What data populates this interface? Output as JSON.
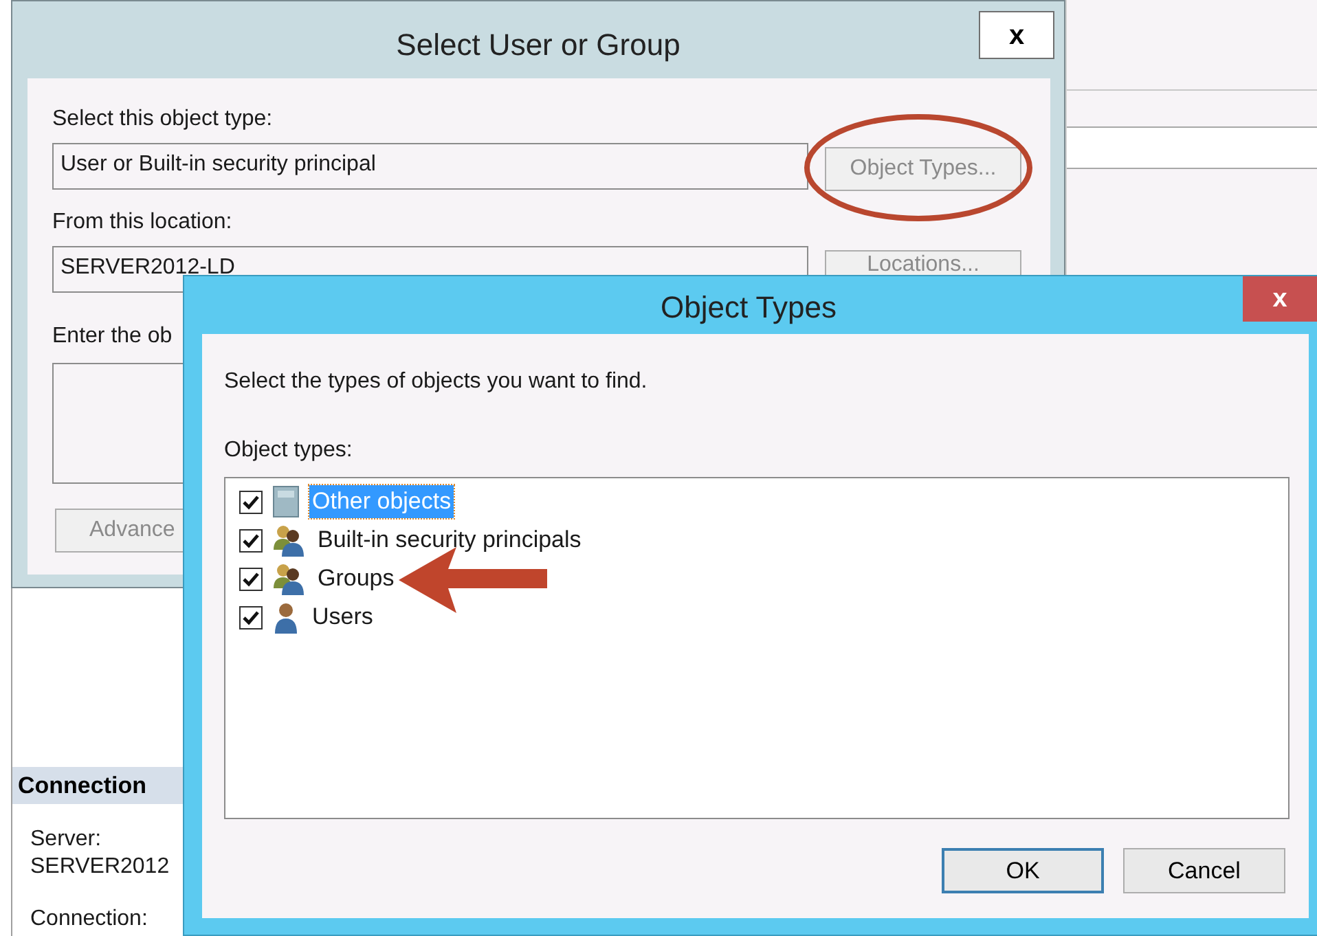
{
  "select_dialog": {
    "title": "Select User or Group",
    "close": "x",
    "object_type_label": "Select this object type:",
    "object_type_value": "User or Built-in security principal",
    "object_types_button": {
      "label": "Object Types...",
      "disabled": true
    },
    "location_label": "From this location:",
    "location_value": "SERVER2012-LD",
    "locations_button": {
      "label": "Locations...",
      "disabled": true
    },
    "names_label": "Enter the ob",
    "advanced_button": {
      "label": "Advance",
      "disabled": true
    }
  },
  "connection_panel": {
    "header": "Connection",
    "lines": [
      "Server:",
      "SERVER2012",
      "Connection:"
    ]
  },
  "object_types_dialog": {
    "title": "Object Types",
    "close": "x",
    "prompt": "Select the types of objects you want to find.",
    "list_label": "Object types:",
    "items": [
      {
        "label": "Other objects",
        "kind": "object",
        "checked": true,
        "selected": true
      },
      {
        "label": "Built-in security principals",
        "kind": "group",
        "checked": true,
        "selected": false
      },
      {
        "label": "Groups",
        "kind": "group",
        "checked": true,
        "selected": false
      },
      {
        "label": "Users",
        "kind": "user",
        "checked": true,
        "selected": false
      }
    ],
    "buttons": [
      {
        "label": "OK",
        "default": true
      },
      {
        "label": "Cancel",
        "default": false
      }
    ]
  }
}
